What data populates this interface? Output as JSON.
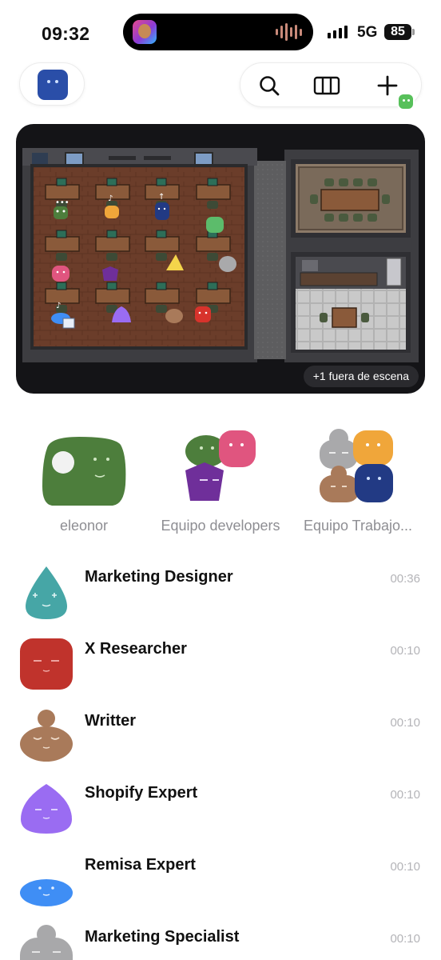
{
  "status_bar": {
    "time": "09:32",
    "network": "5G",
    "battery": "85",
    "now_playing_icon": "music-app-icon"
  },
  "header": {
    "profile_icon": "blue-avatar-icon",
    "actions": [
      {
        "icon": "search-icon"
      },
      {
        "icon": "columns-icon"
      },
      {
        "icon": "plus-icon"
      }
    ],
    "status_indicator_icon": "green-avatar-status-icon"
  },
  "office": {
    "offscreen_badge": "+1 fuera de escena",
    "rooms": [
      "open-office",
      "meeting-room",
      "kitchen"
    ]
  },
  "groups": [
    {
      "name": "eleonor"
    },
    {
      "name": "Equipo developers"
    },
    {
      "name": "Equipo Trabajo..."
    }
  ],
  "chats": [
    {
      "title": "Marketing Designer",
      "time": "00:36",
      "avatar_color": "#46a6a6"
    },
    {
      "title": "X Researcher",
      "time": "00:10",
      "avatar_color": "#c0332c"
    },
    {
      "title": "Writter",
      "time": "00:10",
      "avatar_color": "#a97a5a"
    },
    {
      "title": "Shopify Expert",
      "time": "00:10",
      "avatar_color": "#9a6cf2"
    },
    {
      "title": "Remisa Expert",
      "time": "00:10",
      "avatar_color": "#3f8ef5"
    },
    {
      "title": "Marketing Specialist",
      "time": "00:10",
      "avatar_color": "#a8a8aa"
    }
  ],
  "colors": {
    "accent_green": "#57c05a",
    "muted_text": "#8e8e93",
    "time_text": "#b4b4b8"
  }
}
